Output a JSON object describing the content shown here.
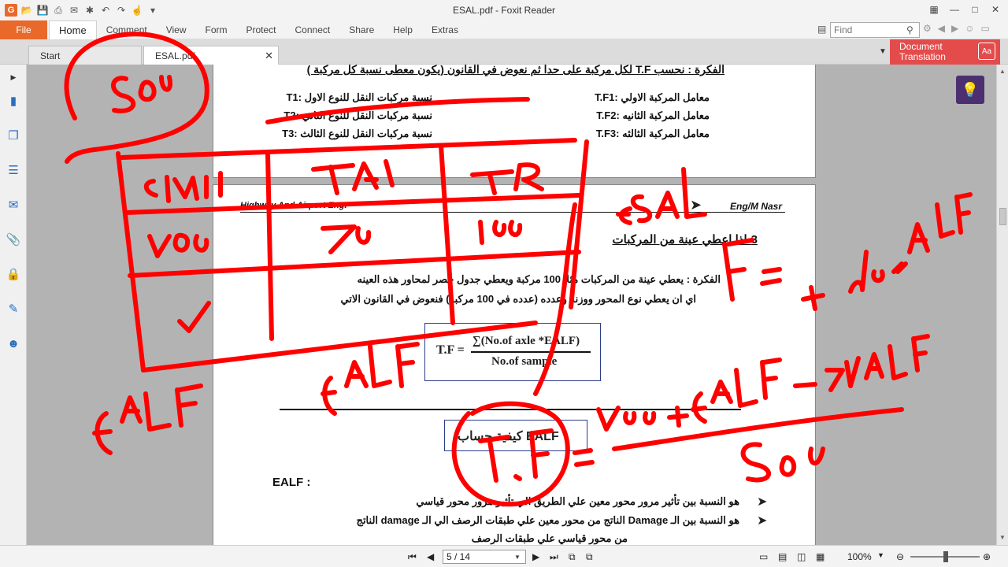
{
  "window": {
    "title": "ESAL.pdf - Foxit Reader"
  },
  "menu": {
    "file": "File",
    "items": [
      "Home",
      "Comment",
      "View",
      "Form",
      "Protect",
      "Connect",
      "Share",
      "Help",
      "Extras"
    ]
  },
  "search": {
    "placeholder": "Find"
  },
  "tabs": {
    "start": "Start",
    "doc": "ESAL.pdf"
  },
  "translate": {
    "line1": "Document",
    "line2": "Translation"
  },
  "page1": {
    "heading": "الفكرة : نحسب T.F لكل مركبة على حدا ثم نعوض في القانون (يكون معطى نسبة كل مركبة )",
    "left": [
      "نسبة مركبات النقل للنوع الاول :T1",
      "نسبة مركبات النقل للنوع الثاني :T2",
      "نسبة مركبات النقل للنوع الثالث :T3"
    ],
    "right": [
      "معامل المركبة الاولي :T.F1",
      "معامل المركبة الثانيه :T.F2",
      "معامل المركبة الثالثه :T.F3"
    ]
  },
  "page2": {
    "header_left": "Highway And Airport Eng.",
    "header_right": "Eng/M Nasr",
    "section": "3-اذا اعطي عينة من المركبات",
    "idea1": "الفكرة : يعطي عينة من المركبات مثلا 100 مركبة ويعطي جدول حصر لمحاور هذه العينه",
    "idea2": "اي ان يعطي نوع المحور ووزنه وعدده (عدده في 100 مركبه)   فنعوض في القانون الاتي",
    "formula": {
      "lhs": "T.F =",
      "numerator": "∑(No.of axle *EALF)",
      "denominator": "No.of sample"
    },
    "box_heading": "كيفية حساب EALF",
    "ealf_label": "EALF :",
    "b1": "هو النسبة بين تأثير مرور محور معين علي الطريق الي تأثير مرور محور قياسي",
    "b2": "هو النسبة بين الـ Damage الناتج من محور معين علي طبقات الرصف الي الـ damage الناتج",
    "b3": "من محور قياسي علي طبقات الرصف"
  },
  "status": {
    "page": "5 / 14",
    "zoom": "100%"
  }
}
